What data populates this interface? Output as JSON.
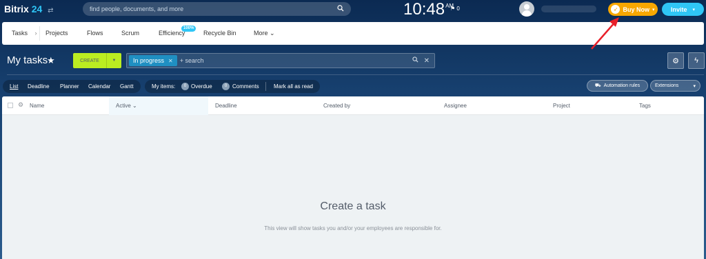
{
  "header": {
    "logo_name": "Bitrix",
    "logo_num": "24",
    "logo_swap": "⇄",
    "search_placeholder": "find people, documents, and more",
    "clock_time": "10:48",
    "clock_ampm": "AM",
    "flag_count": "⚑ 0",
    "buy_label": "Buy Now",
    "invite_label": "Invite"
  },
  "nav": {
    "items": [
      "Tasks",
      "Projects",
      "Flows",
      "Scrum",
      "Efficiency",
      "Recycle Bin",
      "More"
    ],
    "efficiency_badge": "100%",
    "tasks_chevron": "›",
    "more_chevron": "⌄"
  },
  "toolbar": {
    "title": "My tasks",
    "create_label": "CREATE",
    "filter_chip": "In progress",
    "filter_placeholder": "+ search"
  },
  "views": {
    "items": [
      "List",
      "Deadline",
      "Planner",
      "Calendar",
      "Gantt"
    ],
    "active": "List"
  },
  "counters": {
    "label": "My items:",
    "overdue_count": "0",
    "overdue_label": "Overdue",
    "comments_count": "0",
    "comments_label": "Comments",
    "mark_all": "Mark all as read"
  },
  "actions": {
    "automation": "Automation rules",
    "extensions": "Extensions"
  },
  "table": {
    "columns": [
      "Name",
      "Active ⌄",
      "Deadline",
      "Created by",
      "Assignee",
      "Project",
      "Tags"
    ]
  },
  "empty": {
    "title": "Create a task",
    "subtitle": "This view will show tasks you and/or your employees are responsible for."
  },
  "colors": {
    "buy": "#f7a700",
    "invite": "#2fc6f6",
    "create": "#bbed21",
    "arrow": "#e8202a"
  }
}
